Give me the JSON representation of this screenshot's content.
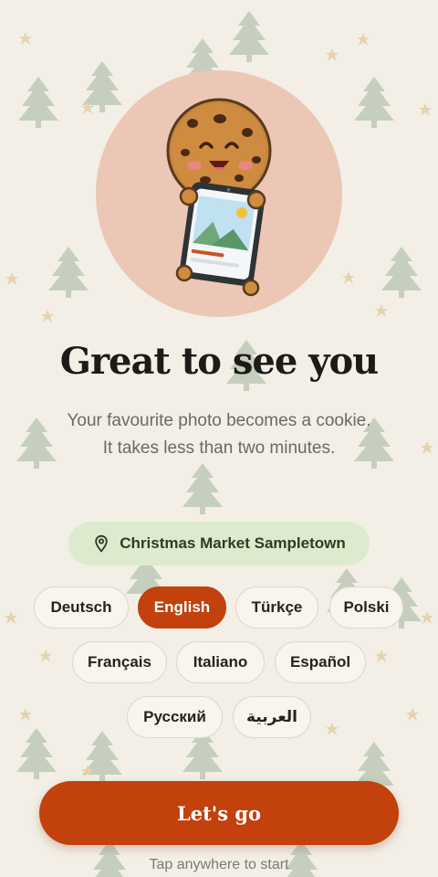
{
  "hero": {
    "illustration": "cookie-holding-phone-icon",
    "circle_color": "#ecc7b5"
  },
  "headline": "Great to see you",
  "subtitle": "Your favourite photo becomes a cookie. It takes less than two minutes.",
  "location": {
    "icon": "location-pin-icon",
    "name": "Christmas Market Sampletown"
  },
  "languages": [
    {
      "label": "Deutsch",
      "selected": false
    },
    {
      "label": "English",
      "selected": true
    },
    {
      "label": "Türkçe",
      "selected": false
    },
    {
      "label": "Polski",
      "selected": false
    },
    {
      "label": "Français",
      "selected": false
    },
    {
      "label": "Italiano",
      "selected": false
    },
    {
      "label": "Español",
      "selected": false
    },
    {
      "label": "Русский",
      "selected": false
    },
    {
      "label": "العربية",
      "selected": false
    }
  ],
  "cta_label": "Let's go",
  "hint": "Tap anywhere to start",
  "colors": {
    "accent": "#c2410c",
    "background": "#f3efe6",
    "location_chip": "#dcebcd",
    "tree": "#c6cfbd",
    "star": "#e6d2b0"
  }
}
